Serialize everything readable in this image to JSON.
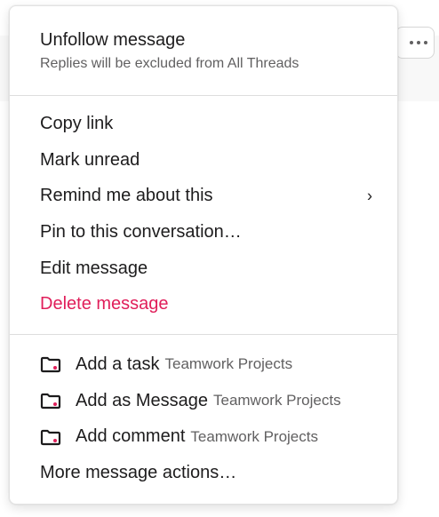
{
  "menu": {
    "unfollow": {
      "title": "Unfollow message",
      "subtitle": "Replies will be excluded from All Threads"
    },
    "actions": [
      {
        "label": "Copy link"
      },
      {
        "label": "Mark unread"
      },
      {
        "label": "Remind me about this",
        "chevron": "›"
      },
      {
        "label": "Pin to this conversation…"
      },
      {
        "label": "Edit message"
      },
      {
        "label": "Delete message"
      }
    ],
    "app_actions": [
      {
        "label": "Add a task",
        "app": "Teamwork Projects",
        "icon": "teamwork-projects-icon"
      },
      {
        "label": "Add as Message",
        "app": "Teamwork Projects",
        "icon": "teamwork-projects-icon"
      },
      {
        "label": "Add comment",
        "app": "Teamwork Projects",
        "icon": "teamwork-projects-icon"
      }
    ],
    "more_actions": "More message actions…"
  },
  "colors": {
    "text": "#1d1c1d",
    "muted": "#616061",
    "danger": "#e01e5a",
    "app_icon_accent": "#e01e5a"
  }
}
